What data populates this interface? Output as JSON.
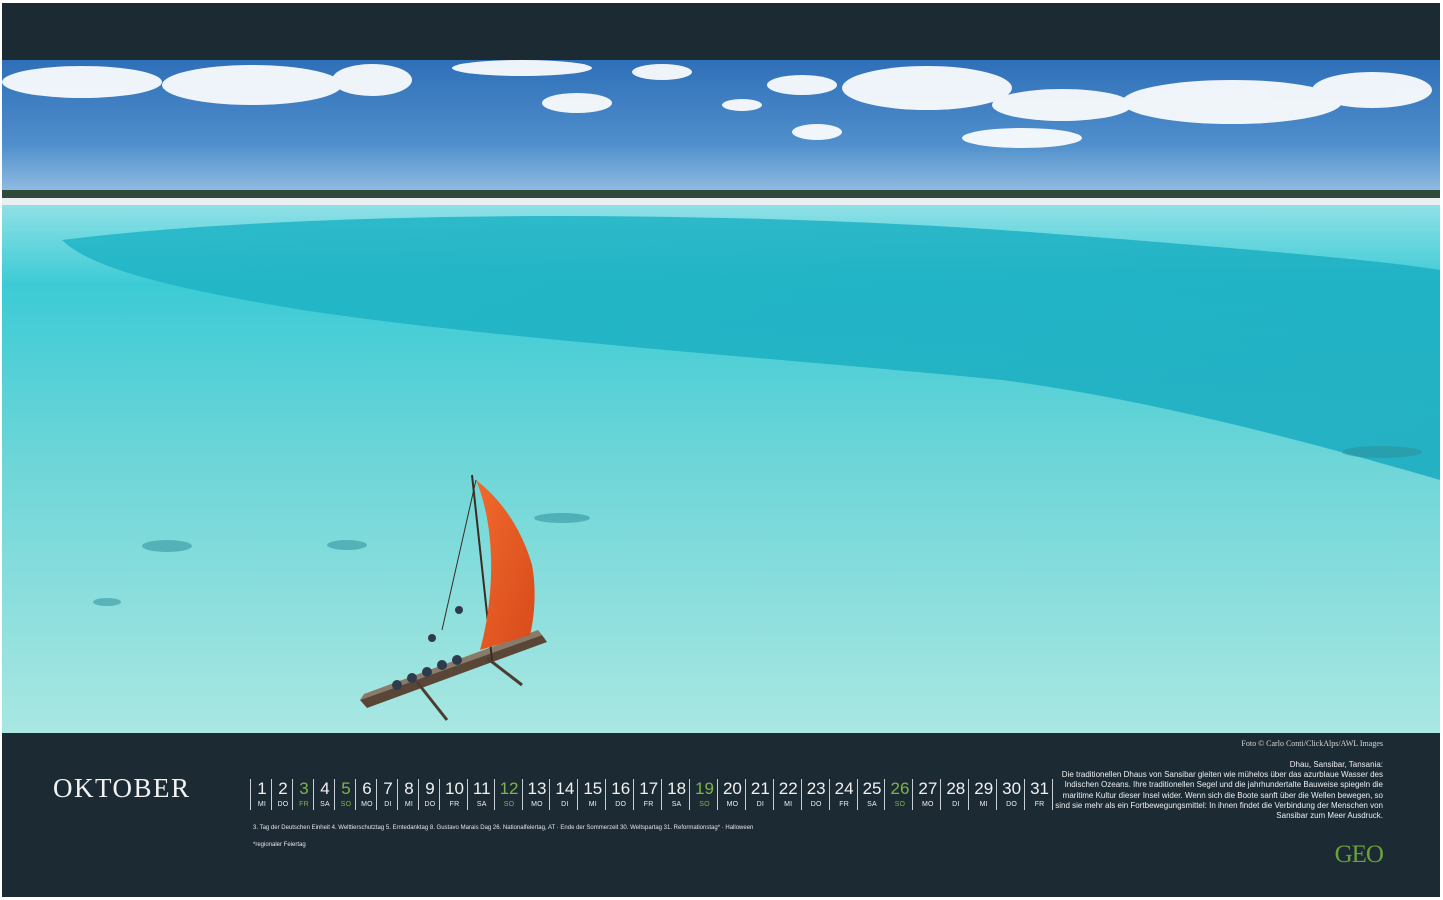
{
  "calendar": {
    "month": "OKTOBER",
    "days": [
      {
        "num": "1",
        "wd": "MI",
        "highlight": false
      },
      {
        "num": "2",
        "wd": "DO",
        "highlight": false
      },
      {
        "num": "3",
        "wd": "FR",
        "highlight": true
      },
      {
        "num": "4",
        "wd": "SA",
        "highlight": false
      },
      {
        "num": "5",
        "wd": "SO",
        "highlight": true
      },
      {
        "num": "6",
        "wd": "MO",
        "highlight": false
      },
      {
        "num": "7",
        "wd": "DI",
        "highlight": false
      },
      {
        "num": "8",
        "wd": "MI",
        "highlight": false
      },
      {
        "num": "9",
        "wd": "DO",
        "highlight": false
      },
      {
        "num": "10",
        "wd": "FR",
        "highlight": false
      },
      {
        "num": "11",
        "wd": "SA",
        "highlight": false
      },
      {
        "num": "12",
        "wd": "SO",
        "highlight": true
      },
      {
        "num": "13",
        "wd": "MO",
        "highlight": false
      },
      {
        "num": "14",
        "wd": "DI",
        "highlight": false
      },
      {
        "num": "15",
        "wd": "MI",
        "highlight": false
      },
      {
        "num": "16",
        "wd": "DO",
        "highlight": false
      },
      {
        "num": "17",
        "wd": "FR",
        "highlight": false
      },
      {
        "num": "18",
        "wd": "SA",
        "highlight": false
      },
      {
        "num": "19",
        "wd": "SO",
        "highlight": true
      },
      {
        "num": "20",
        "wd": "MO",
        "highlight": false
      },
      {
        "num": "21",
        "wd": "DI",
        "highlight": false
      },
      {
        "num": "22",
        "wd": "MI",
        "highlight": false
      },
      {
        "num": "23",
        "wd": "DO",
        "highlight": false
      },
      {
        "num": "24",
        "wd": "FR",
        "highlight": false
      },
      {
        "num": "25",
        "wd": "SA",
        "highlight": false
      },
      {
        "num": "26",
        "wd": "SO",
        "highlight": true
      },
      {
        "num": "27",
        "wd": "MO",
        "highlight": false
      },
      {
        "num": "28",
        "wd": "DI",
        "highlight": false
      },
      {
        "num": "29",
        "wd": "MI",
        "highlight": false
      },
      {
        "num": "30",
        "wd": "DO",
        "highlight": false
      },
      {
        "num": "31",
        "wd": "FR",
        "highlight": false
      }
    ],
    "holidays": "3. Tag der Deutschen Einheit   4. Welttierschutztag   5. Erntedanktag   8. Gustavo Marais Dag   26. Nationalfeiertag, AT · Ende der Sommerzeit   30. Weltspartag   31. Reformationstag* · Halloween",
    "footnote": "*regionaler Feiertag"
  },
  "photo": {
    "credit": "Foto © Carlo Conti/ClickAlps/AWL Images",
    "caption_title": "Dhau, Sansibar, Tansania:",
    "caption_text": "Die traditionellen Dhaus von Sansibar gleiten wie mühelos über das azurblaue Wasser des Indischen Ozeans. Ihre traditionellen Segel und die jahrhundertalte Bauweise spiegeln die maritime Kultur dieser Insel wider. Wenn sich die Boote sanft über die Wellen bewegen, so sind sie mehr als ein Fortbewegungsmittel: In ihnen findet die Verbindung der Menschen von Sansibar zum Meer Ausdruck."
  },
  "brand": {
    "logo": "GEO",
    "highlight_color": "#7fb44a",
    "background_color": "#1b2a33"
  }
}
